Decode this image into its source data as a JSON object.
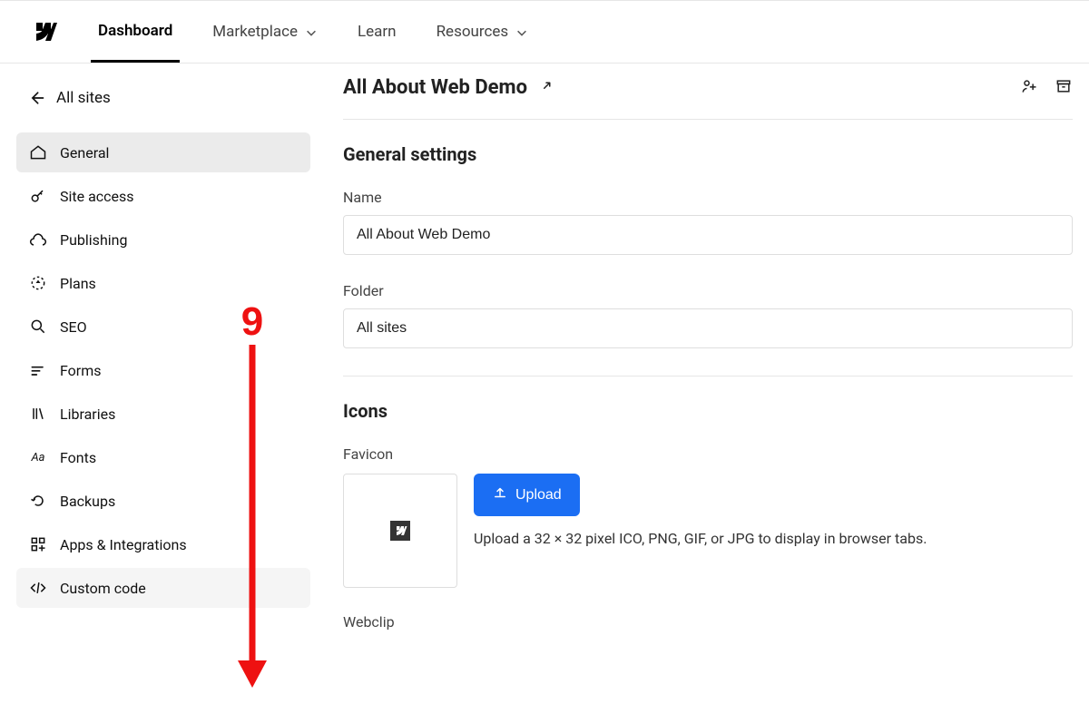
{
  "topnav": {
    "items": [
      {
        "label": "Dashboard",
        "has_dropdown": false
      },
      {
        "label": "Marketplace",
        "has_dropdown": true
      },
      {
        "label": "Learn",
        "has_dropdown": false
      },
      {
        "label": "Resources",
        "has_dropdown": true
      }
    ],
    "active_index": 0
  },
  "sidebar": {
    "back_label": "All sites",
    "items": [
      {
        "label": "General",
        "icon": "home-icon"
      },
      {
        "label": "Site access",
        "icon": "key-icon"
      },
      {
        "label": "Publishing",
        "icon": "publish-icon"
      },
      {
        "label": "Plans",
        "icon": "plans-icon"
      },
      {
        "label": "SEO",
        "icon": "search-icon"
      },
      {
        "label": "Forms",
        "icon": "forms-icon"
      },
      {
        "label": "Libraries",
        "icon": "libraries-icon"
      },
      {
        "label": "Fonts",
        "icon": "fonts-icon"
      },
      {
        "label": "Backups",
        "icon": "undo-icon"
      },
      {
        "label": "Apps & Integrations",
        "icon": "apps-icon"
      },
      {
        "label": "Custom code",
        "icon": "code-icon"
      }
    ],
    "selected_index": 0,
    "highlighted_index": 10
  },
  "header": {
    "title": "All About Web Demo"
  },
  "general": {
    "section_title": "General settings",
    "name_label": "Name",
    "name_value": "All About Web Demo",
    "folder_label": "Folder",
    "folder_value": "All sites"
  },
  "icons_section": {
    "section_title": "Icons",
    "favicon_label": "Favicon",
    "upload_label": "Upload",
    "favicon_hint": "Upload a 32 × 32 pixel ICO, PNG, GIF, or JPG to display in browser tabs.",
    "webclip_label": "Webclip"
  },
  "annotation": {
    "number": "9"
  }
}
